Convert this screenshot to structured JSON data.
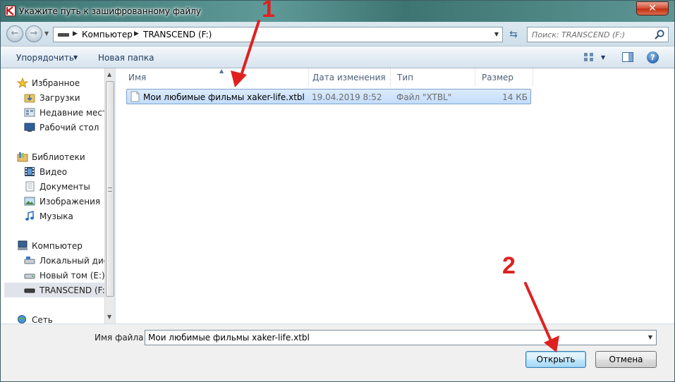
{
  "window": {
    "title": "Укажите путь к зашифрованному файлу",
    "close_glyph": "✕"
  },
  "address_bar": {
    "crumbs": [
      "Компьютер",
      "TRANSCEND (F:)"
    ],
    "search_placeholder": "Поиск: TRANSCEND (F:)"
  },
  "toolbar": {
    "organize_label": "Упорядочить",
    "new_folder_label": "Новая папка",
    "help_glyph": "?"
  },
  "sidebar": {
    "items": [
      {
        "label": "Избранное",
        "icon": "star-icon",
        "level": 0
      },
      {
        "label": "Загрузки",
        "icon": "downloads-folder-icon",
        "level": 1
      },
      {
        "label": "Недавние места",
        "icon": "recent-places-icon",
        "level": 1
      },
      {
        "label": "Рабочий стол",
        "icon": "desktop-icon",
        "level": 1
      },
      {
        "label": "Библиотеки",
        "icon": "libraries-icon",
        "level": 0
      },
      {
        "label": "Видео",
        "icon": "video-icon",
        "level": 1
      },
      {
        "label": "Документы",
        "icon": "documents-icon",
        "level": 1
      },
      {
        "label": "Изображения",
        "icon": "pictures-icon",
        "level": 1
      },
      {
        "label": "Музыка",
        "icon": "music-icon",
        "level": 1
      },
      {
        "label": "Компьютер",
        "icon": "computer-icon",
        "level": 0
      },
      {
        "label": "Локальный диск",
        "icon": "local-disk-icon",
        "level": 1
      },
      {
        "label": "Новый том (E:)",
        "icon": "drive-icon",
        "level": 1
      },
      {
        "label": "TRANSCEND (F:)",
        "icon": "usb-drive-icon",
        "level": 1,
        "selected": true
      },
      {
        "label": "Сеть",
        "icon": "network-icon",
        "level": 0
      }
    ]
  },
  "file_list": {
    "columns": [
      "Имя",
      "Дата изменения",
      "Тип",
      "Размер"
    ],
    "rows": [
      {
        "name": "Мои любимые фильмы xaker-life.xtbl",
        "modified": "19.04.2019 8:52",
        "type": "Файл \"XTBL\"",
        "size": "14 КБ"
      }
    ]
  },
  "footer": {
    "filename_label": "Имя файла:",
    "filename_value": "Мои любимые фильмы xaker-life.xtbl",
    "open_label": "Открыть",
    "cancel_label": "Отмена"
  },
  "annotations": {
    "marker_1": "1",
    "marker_2": "2",
    "color": "#e02020"
  }
}
